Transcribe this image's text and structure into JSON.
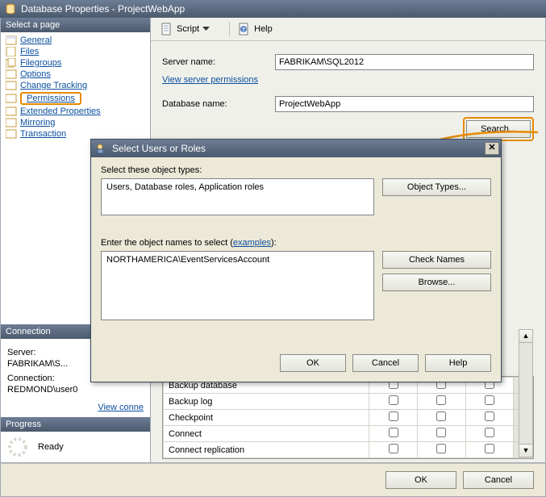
{
  "window": {
    "title": "Database Properties - ProjectWebApp"
  },
  "left": {
    "select_page_hdr": "Select a page",
    "nav": [
      "General",
      "Files",
      "Filegroups",
      "Options",
      "Change Tracking",
      "Permissions",
      "Extended Properties",
      "Mirroring",
      "Transaction"
    ],
    "connection_hdr": "Connection",
    "server_lbl": "Server:",
    "server_val": "FABRIKAM\\S...",
    "conn_lbl": "Connection:",
    "conn_val": "REDMOND\\user0",
    "view_conn_link": "View conne",
    "progress_hdr": "Progress",
    "progress_val": "Ready"
  },
  "toolbar": {
    "script": "Script",
    "help": "Help"
  },
  "form": {
    "server_name_lbl": "Server name:",
    "server_name_val": "FABRIKAM\\SQL2012",
    "view_perm_link": "View server permissions",
    "db_name_lbl": "Database name:",
    "db_name_val": "ProjectWebApp",
    "search_btn": "Search..."
  },
  "perms": {
    "rows": [
      "Backup database",
      "Backup log",
      "Checkpoint",
      "Connect",
      "Connect replication"
    ]
  },
  "dialog": {
    "title": "Select Users or Roles",
    "types_lbl": "Select these object types:",
    "types_val": "Users, Database roles, Application roles",
    "object_types_btn": "Object Types...",
    "names_lbl_a": "Enter the object names to select (",
    "names_lbl_link": "examples",
    "names_lbl_b": "):",
    "names_val": "NORTHAMERICA\\EventServicesAccount",
    "check_btn": "Check Names",
    "browse_btn": "Browse...",
    "ok": "OK",
    "cancel": "Cancel",
    "help": "Help"
  },
  "bottom": {
    "ok": "OK",
    "cancel": "Cancel"
  }
}
